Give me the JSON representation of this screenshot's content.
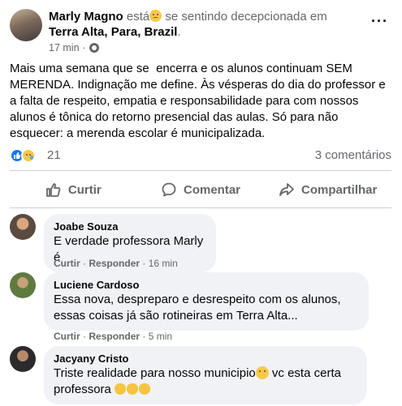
{
  "post": {
    "author": "Marly Magno",
    "feeling_prefix": "está",
    "feeling_suffix": "se sentindo decepcionada em",
    "location": "Terra Alta, Para, Brazil",
    "location_suffix": ".",
    "timestamp": "17 min",
    "separator": "·",
    "more_label": "···",
    "text": "Mais uma semana que se  encerra e os alunos continuam SEM MERENDA. Indignação me define. Às vésperas do dia do professor e a falta de respeito, empatia e responsabilidade para com nossos alunos é tônica do retorno presencial das aulas. Só para não esquecer: a merenda escolar é municipalizada."
  },
  "reactions": {
    "count": "21",
    "comments_count": "3 comentários",
    "icons": [
      "like-icon",
      "sad-icon"
    ]
  },
  "actions": {
    "like": "Curtir",
    "comment": "Comentar",
    "share": "Compartilhar"
  },
  "comments": [
    {
      "name": "Joabe Souza",
      "text": "E verdade professora Marly é",
      "like": "Curtir",
      "sep": "·",
      "reply": "Responder",
      "time": "16 min"
    },
    {
      "name": "Luciene Cardoso",
      "text_line1": "Essa nova, despreparo e desrespeito com os alunos,",
      "text_line2": "essas coisas já são rotineiras em Terra Alta...",
      "like": "Curtir",
      "sep": "·",
      "reply": "Responder",
      "time": "5 min"
    },
    {
      "name": "Jacyany Cristo",
      "text_line1": "Triste realidade para nosso municipio",
      "text_line1_suffix": " vc esta certa",
      "text_line2": "professora ",
      "emoji_note": "three clapping-hands emoji"
    }
  ],
  "colors": {
    "primary_text": "#050505",
    "secondary_text": "#65676b",
    "bubble": "#f0f2f5",
    "like_blue": "#1877f2",
    "divider": "#ced0d4"
  }
}
